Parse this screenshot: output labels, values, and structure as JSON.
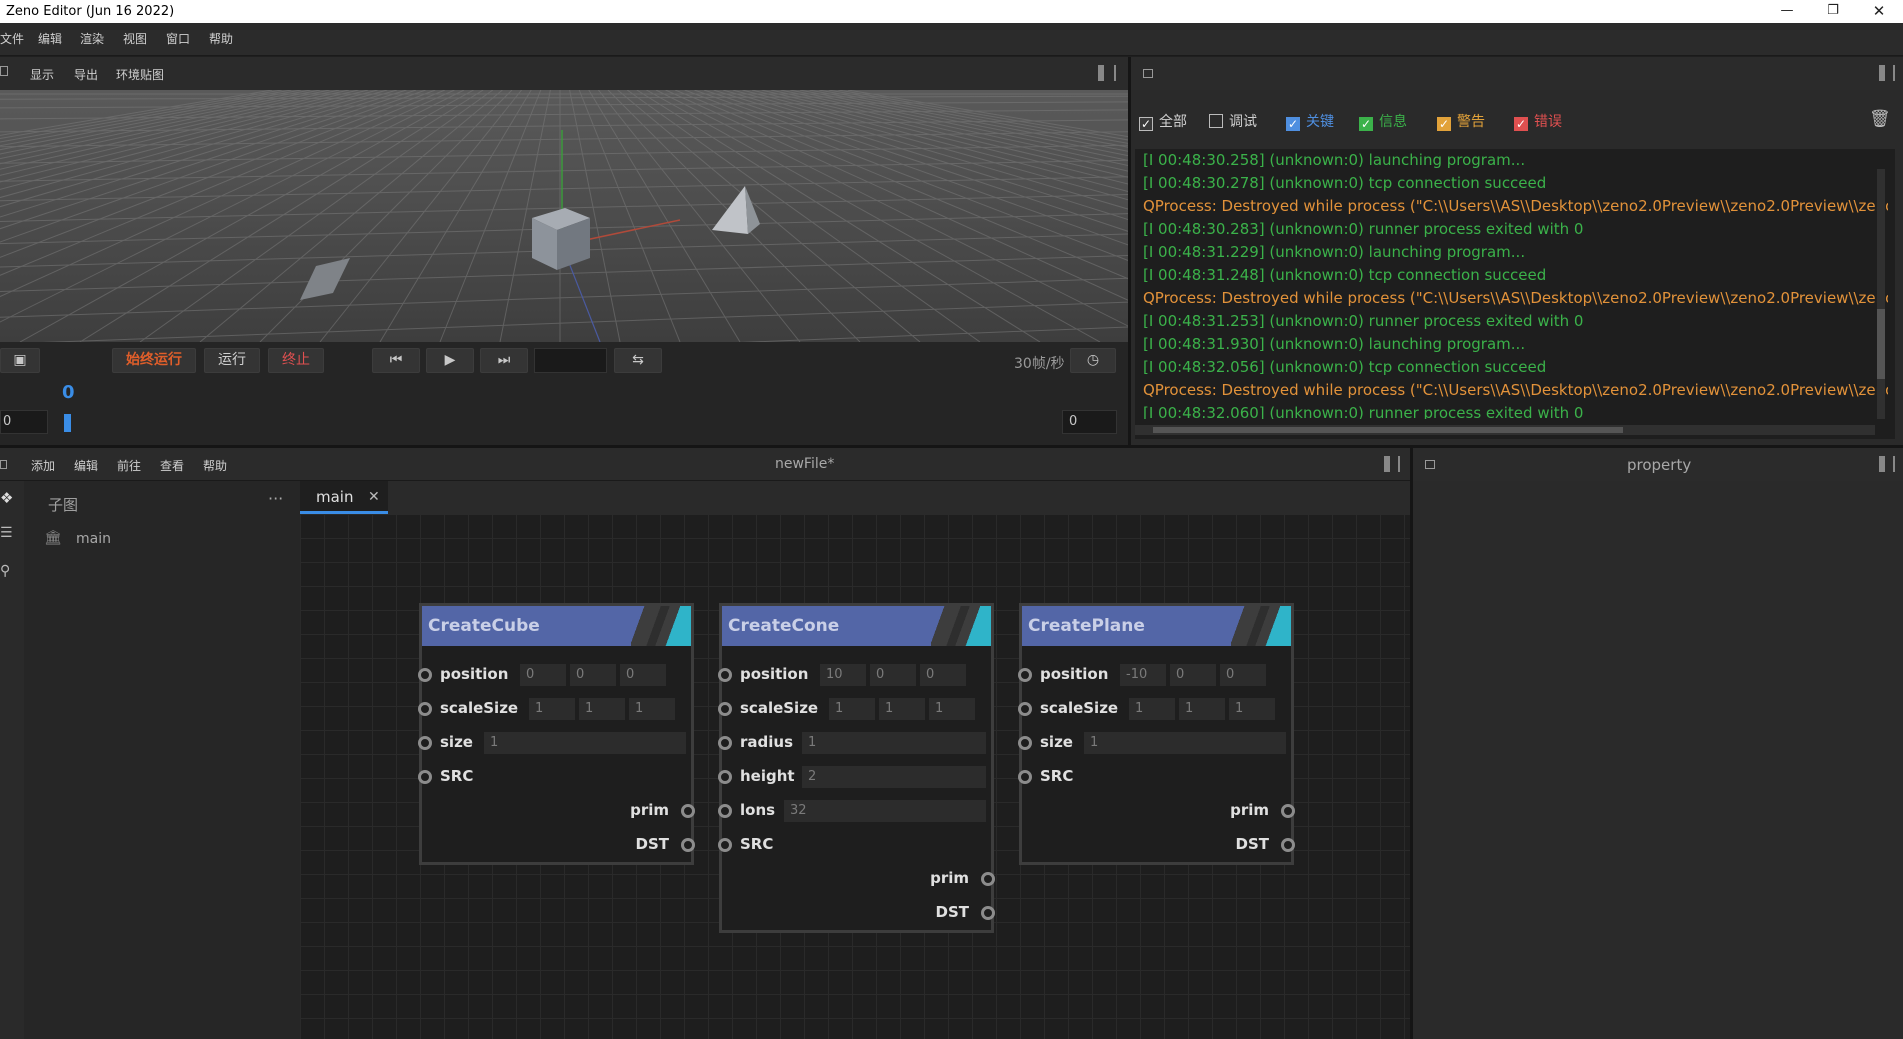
{
  "window": {
    "title": "Zeno Editor (Jun 16 2022)"
  },
  "menu": [
    "文件",
    "编辑",
    "渲染",
    "视图",
    "窗口",
    "帮助"
  ],
  "viewport": {
    "toolbar": [
      "显示",
      "导出",
      "环境贴图"
    ],
    "controls": {
      "always_run": "始终运行",
      "run": "运行",
      "stop": "终止",
      "fps": "30帧/秒"
    },
    "timeline": {
      "current_frame": "0",
      "start": "0",
      "end": "0"
    }
  },
  "log": {
    "filters": [
      {
        "label": "全部",
        "checked": true,
        "color": "#d0d0d0"
      },
      {
        "label": "调试",
        "checked": false,
        "color": "#d0d0d0"
      },
      {
        "label": "关键",
        "checked": true,
        "color": "#4f8fe0"
      },
      {
        "label": "信息",
        "checked": true,
        "color": "#3bb24a"
      },
      {
        "label": "警告",
        "checked": true,
        "color": "#e2a23a"
      },
      {
        "label": "错误",
        "checked": true,
        "color": "#e05050"
      }
    ],
    "lines": [
      {
        "level": "info",
        "text": "[I 00:48:30.258] (unknown:0) launching program..."
      },
      {
        "level": "info",
        "text": "[I 00:48:30.278] (unknown:0) tcp connection succeed"
      },
      {
        "level": "warn",
        "text": "QProcess: Destroyed while process (\"C:\\\\Users\\\\AS\\\\Desktop\\\\zeno2.0Preview\\\\zeno2.0Preview\\\\zenoe"
      },
      {
        "level": "info",
        "text": "[I 00:48:30.283] (unknown:0) runner process exited with 0"
      },
      {
        "level": "info",
        "text": "[I 00:48:31.229] (unknown:0) launching program..."
      },
      {
        "level": "info",
        "text": "[I 00:48:31.248] (unknown:0) tcp connection succeed"
      },
      {
        "level": "warn",
        "text": "QProcess: Destroyed while process (\"C:\\\\Users\\\\AS\\\\Desktop\\\\zeno2.0Preview\\\\zeno2.0Preview\\\\zenoe"
      },
      {
        "level": "info",
        "text": "[I 00:48:31.253] (unknown:0) runner process exited with 0"
      },
      {
        "level": "info",
        "text": "[I 00:48:31.930] (unknown:0) launching program..."
      },
      {
        "level": "info",
        "text": "[I 00:48:32.056] (unknown:0) tcp connection succeed"
      },
      {
        "level": "warn",
        "text": "QProcess: Destroyed while process (\"C:\\\\Users\\\\AS\\\\Desktop\\\\zeno2.0Preview\\\\zeno2.0Preview\\\\zenoe"
      },
      {
        "level": "info",
        "text": "[I 00:48:32.060] (unknown:0) runner process exited with 0"
      }
    ]
  },
  "editor": {
    "menu": [
      "添加",
      "编辑",
      "前往",
      "查看",
      "帮助"
    ],
    "file_title": "newFile*",
    "subgraph_header": "子图",
    "subgraph_more": "···",
    "subgraphs": [
      "main"
    ],
    "tab": "main",
    "tab_close": "✕"
  },
  "property": {
    "title": "property"
  },
  "nodes": [
    {
      "name": "CreateCube",
      "inputs": [
        {
          "label": "position",
          "values": [
            "0",
            "0",
            "0"
          ]
        },
        {
          "label": "scaleSize",
          "values": [
            "1",
            "1",
            "1"
          ]
        },
        {
          "label": "size",
          "values": [
            "1"
          ]
        },
        {
          "label": "SRC",
          "values": []
        }
      ],
      "outputs": [
        "prim",
        "DST"
      ]
    },
    {
      "name": "CreateCone",
      "inputs": [
        {
          "label": "position",
          "values": [
            "10",
            "0",
            "0"
          ]
        },
        {
          "label": "scaleSize",
          "values": [
            "1",
            "1",
            "1"
          ]
        },
        {
          "label": "radius",
          "values": [
            "1"
          ]
        },
        {
          "label": "height",
          "values": [
            "2"
          ]
        },
        {
          "label": "lons",
          "values": [
            "32"
          ]
        },
        {
          "label": "SRC",
          "values": []
        }
      ],
      "outputs": [
        "prim",
        "DST"
      ]
    },
    {
      "name": "CreatePlane",
      "inputs": [
        {
          "label": "position",
          "values": [
            "-10",
            "0",
            "0"
          ]
        },
        {
          "label": "scaleSize",
          "values": [
            "1",
            "1",
            "1"
          ]
        },
        {
          "label": "size",
          "values": [
            "1"
          ]
        },
        {
          "label": "SRC",
          "values": []
        }
      ],
      "outputs": [
        "prim",
        "DST"
      ]
    }
  ]
}
